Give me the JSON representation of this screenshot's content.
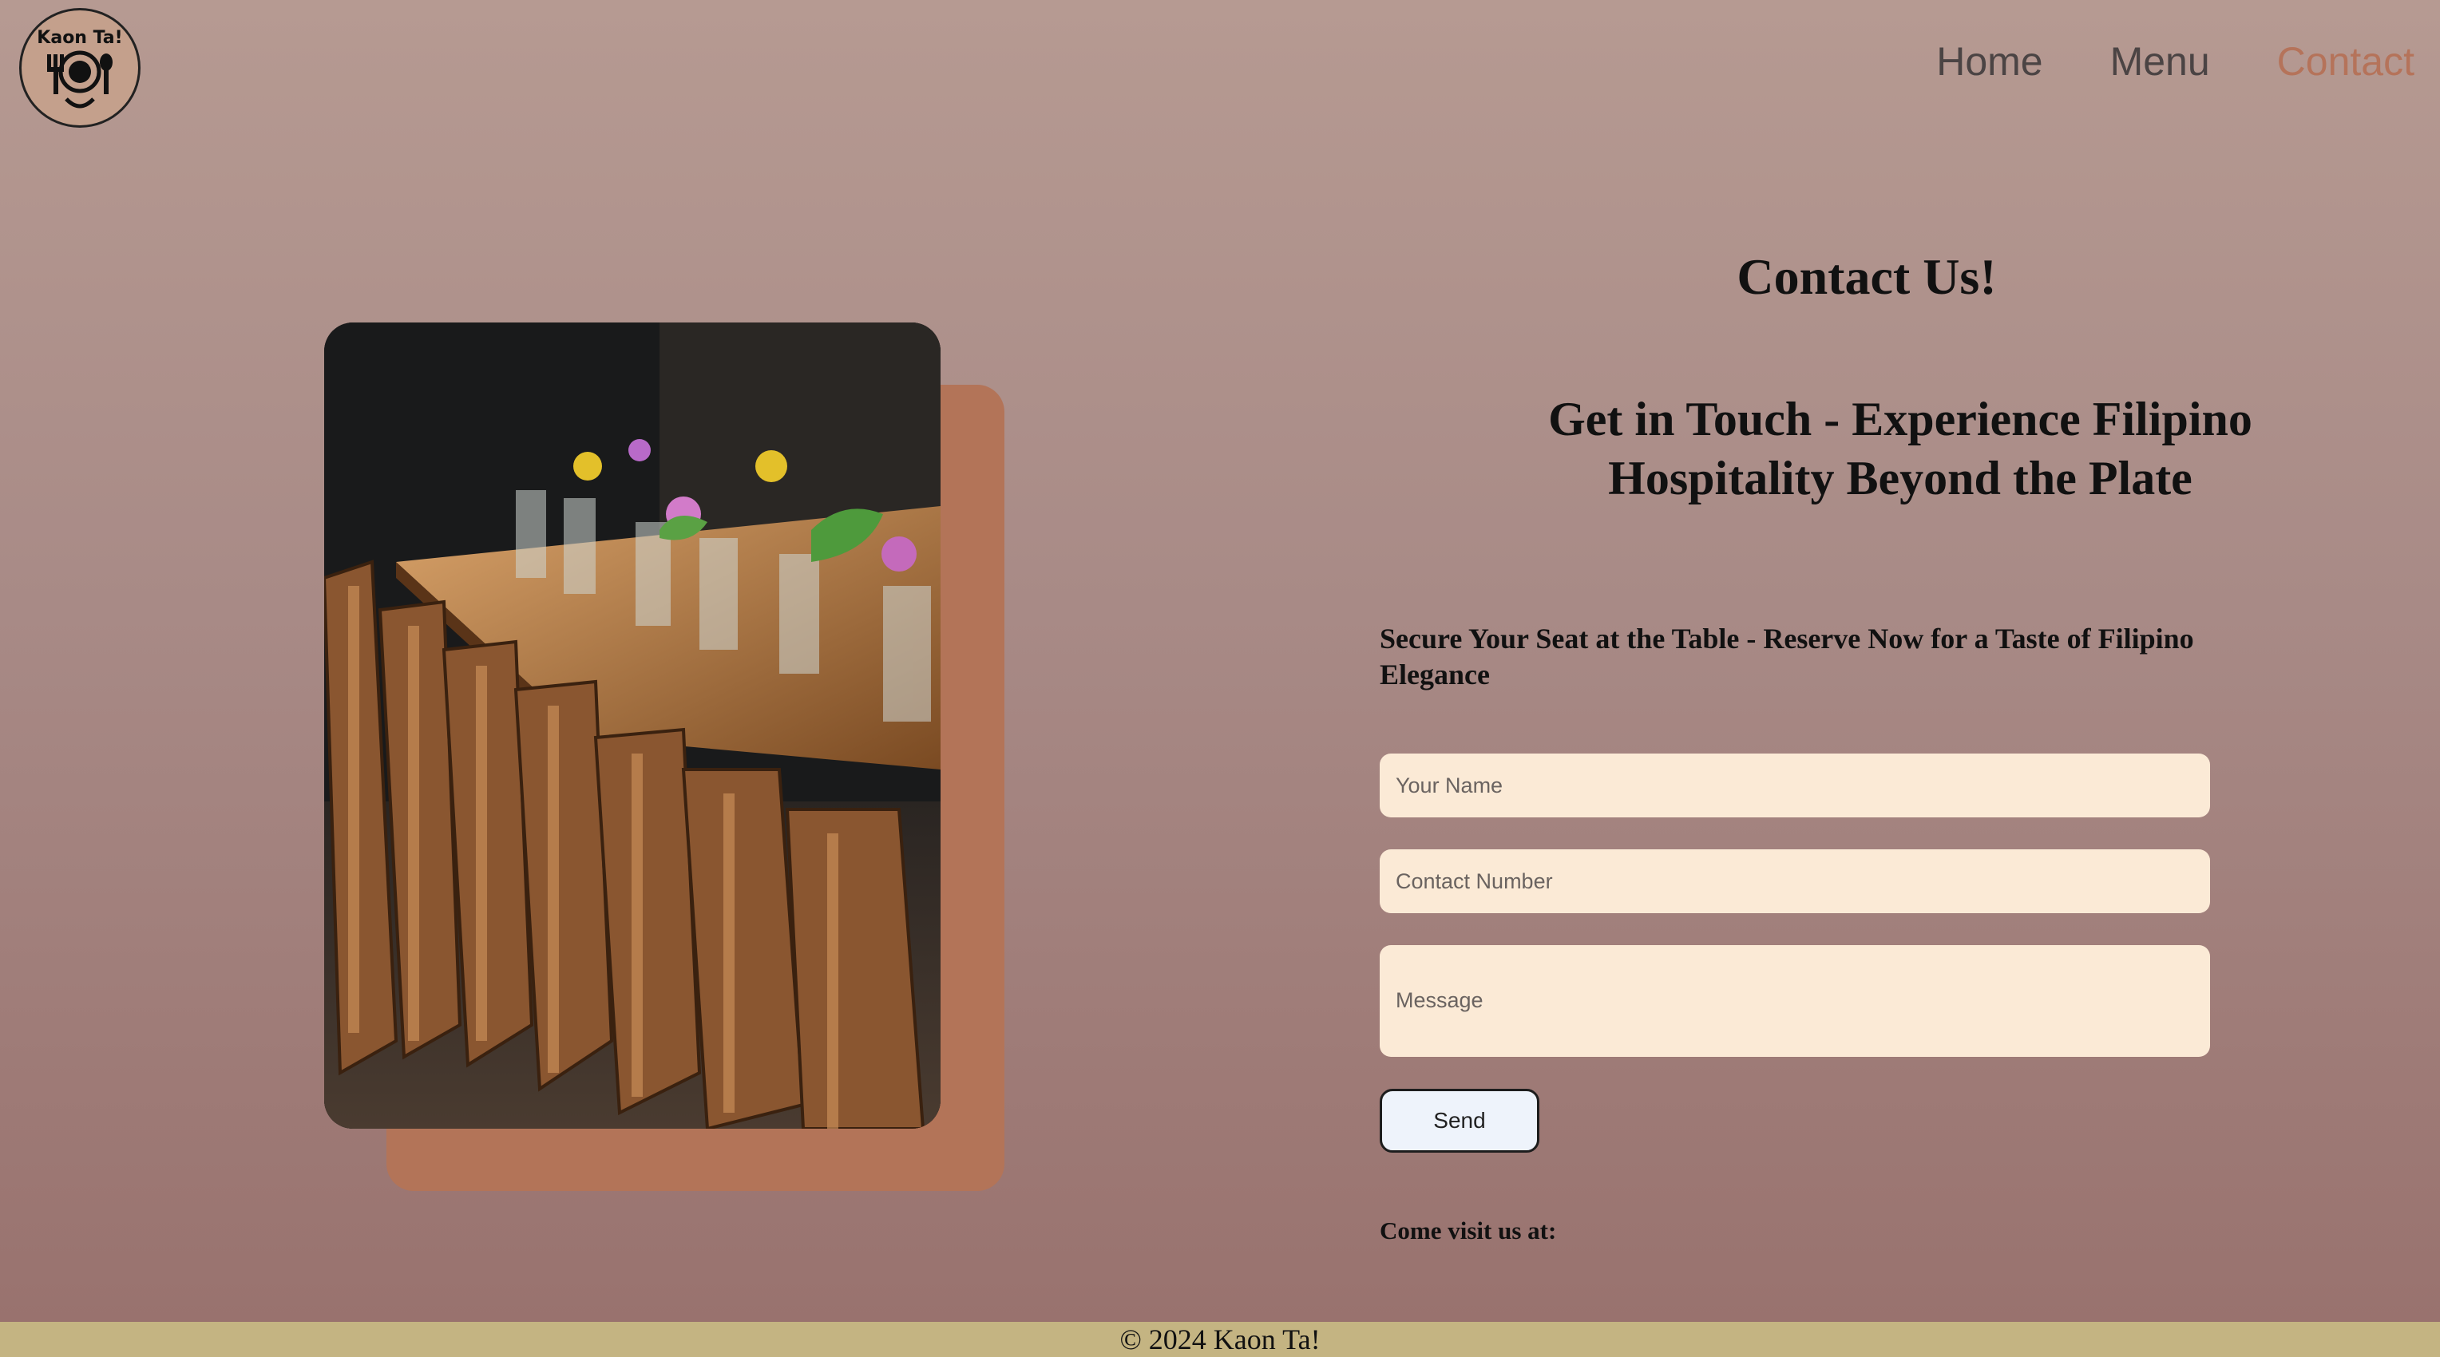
{
  "brand": {
    "logo_text": "Kaon Ta!",
    "logo_icon": "plate-fork-spoon-icon"
  },
  "nav": {
    "items": [
      {
        "label": "Home",
        "active": false
      },
      {
        "label": "Menu",
        "active": false
      },
      {
        "label": "Contact",
        "active": true
      }
    ]
  },
  "hero_image": {
    "subject": "restaurant-long-table-with-wooden-chairs-and-flowers"
  },
  "main": {
    "title": "Contact Us!",
    "subtitle": "Get in Touch - Experience Filipino Hospitality Beyond the Plate",
    "reserve_text": "Secure Your Seat at the Table - Reserve Now for a Taste of Filipino Elegance"
  },
  "form": {
    "name_placeholder": "Your Name",
    "phone_placeholder": "Contact Number",
    "message_placeholder": "Message",
    "send_label": "Send"
  },
  "visit_label": "Come visit us at:",
  "footer": {
    "text": "© 2024 Kaon Ta!"
  },
  "colors": {
    "accent": "#b5735a",
    "nav_text": "#4b4444",
    "field_bg": "#fbead6",
    "footer_bg": "#c4b482",
    "image_shadow": "#b37458"
  }
}
